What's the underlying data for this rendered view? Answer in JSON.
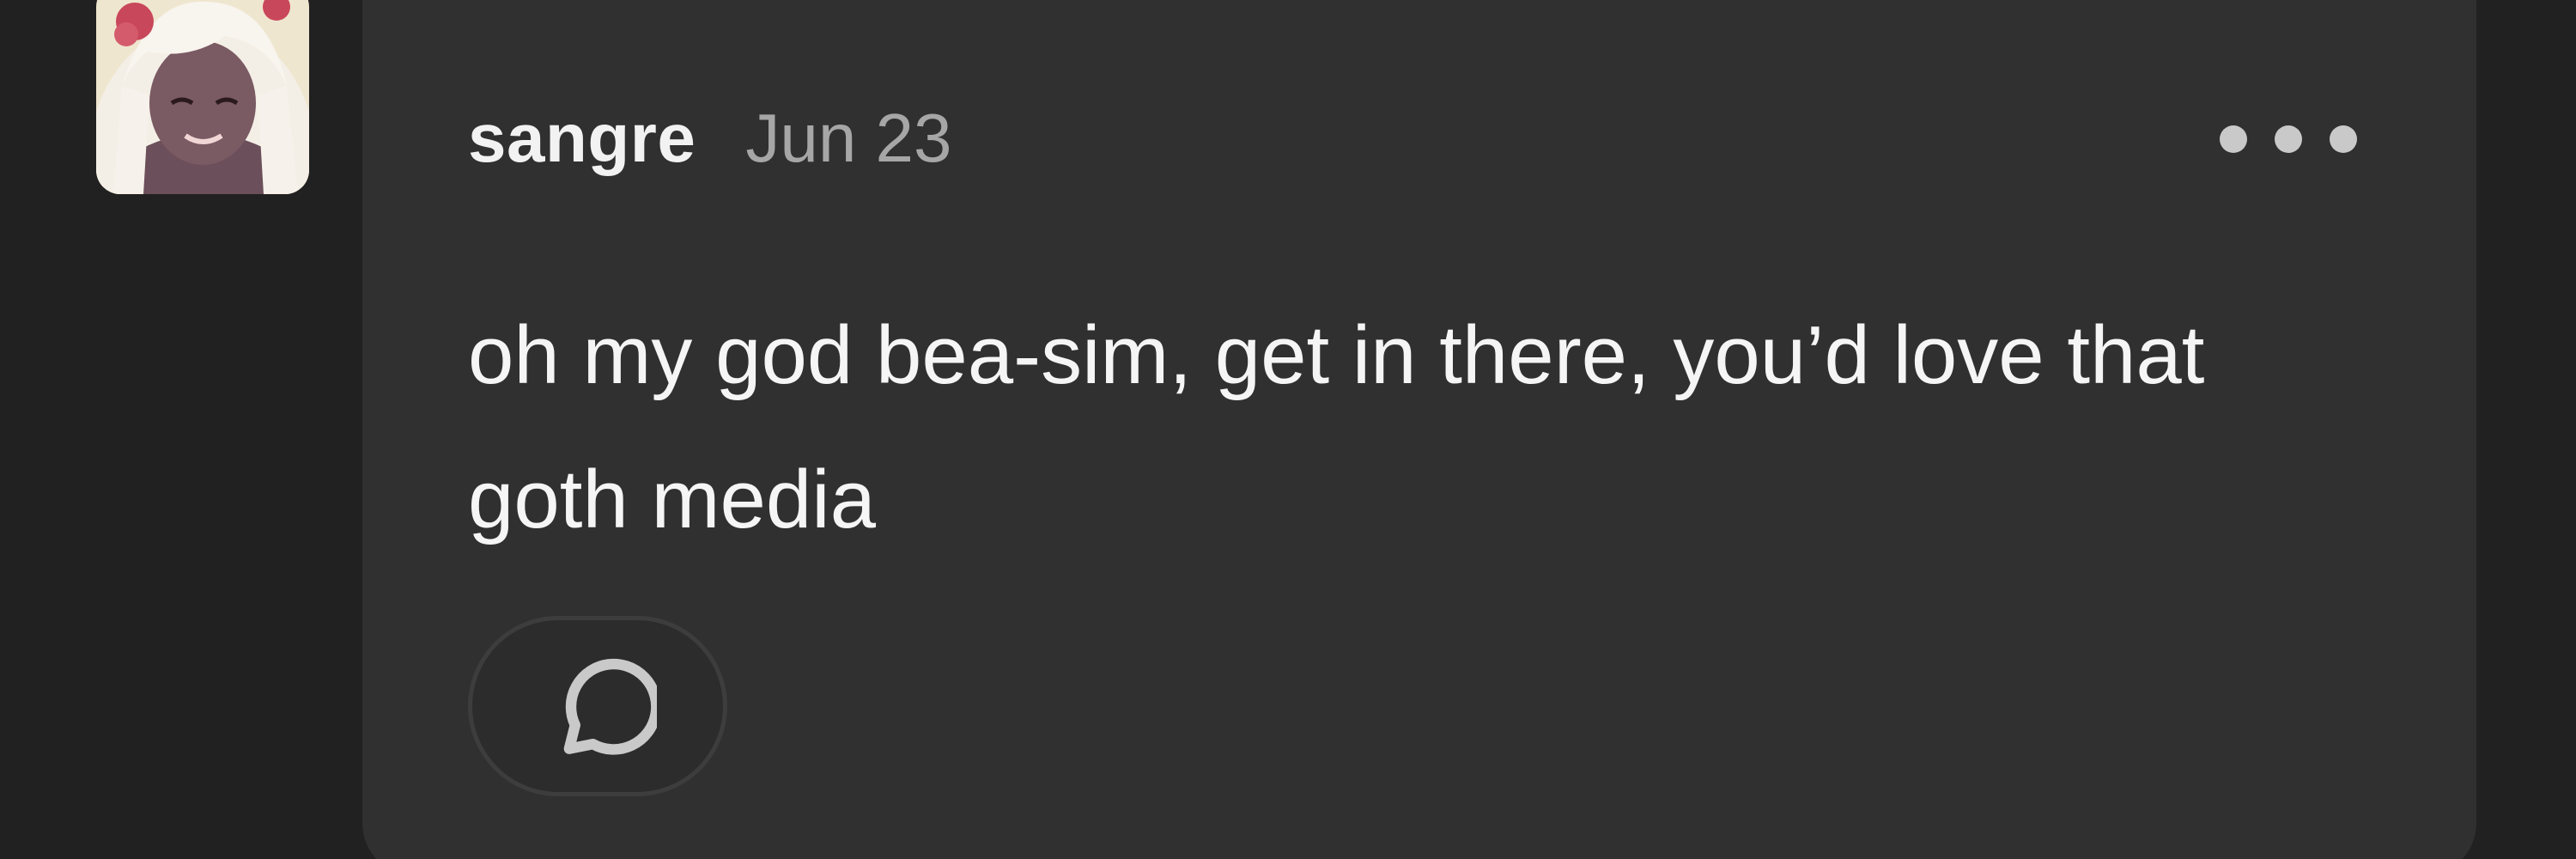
{
  "comment": {
    "username": "sangre",
    "timestamp": "Jun 23",
    "text": "oh my god bea-sim, get in there, you’d love that goth media",
    "avatar_icon": "user-avatar-illustration",
    "more_icon": "more-options-icon",
    "reply_icon": "speech-bubble-icon"
  },
  "colors": {
    "background": "#212121",
    "card": "#303030",
    "username": "#f2f2f2",
    "timestamp": "#a6a6a6",
    "text": "#f5f5f5",
    "icon": "#c9c9c9"
  }
}
